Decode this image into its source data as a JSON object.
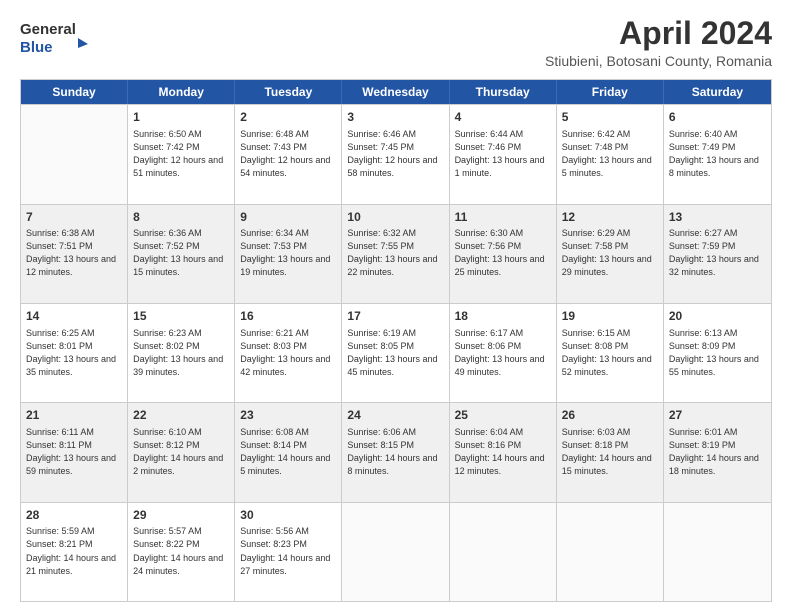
{
  "header": {
    "logo_line1": "General",
    "logo_line2": "Blue",
    "title": "April 2024",
    "subtitle": "Stiubieni, Botosani County, Romania"
  },
  "days_of_week": [
    "Sunday",
    "Monday",
    "Tuesday",
    "Wednesday",
    "Thursday",
    "Friday",
    "Saturday"
  ],
  "weeks": [
    [
      {
        "day": "",
        "info": ""
      },
      {
        "day": "1",
        "info": "Sunrise: 6:50 AM\nSunset: 7:42 PM\nDaylight: 12 hours\nand 51 minutes."
      },
      {
        "day": "2",
        "info": "Sunrise: 6:48 AM\nSunset: 7:43 PM\nDaylight: 12 hours\nand 54 minutes."
      },
      {
        "day": "3",
        "info": "Sunrise: 6:46 AM\nSunset: 7:45 PM\nDaylight: 12 hours\nand 58 minutes."
      },
      {
        "day": "4",
        "info": "Sunrise: 6:44 AM\nSunset: 7:46 PM\nDaylight: 13 hours\nand 1 minute."
      },
      {
        "day": "5",
        "info": "Sunrise: 6:42 AM\nSunset: 7:48 PM\nDaylight: 13 hours\nand 5 minutes."
      },
      {
        "day": "6",
        "info": "Sunrise: 6:40 AM\nSunset: 7:49 PM\nDaylight: 13 hours\nand 8 minutes."
      }
    ],
    [
      {
        "day": "7",
        "info": "Sunrise: 6:38 AM\nSunset: 7:51 PM\nDaylight: 13 hours\nand 12 minutes."
      },
      {
        "day": "8",
        "info": "Sunrise: 6:36 AM\nSunset: 7:52 PM\nDaylight: 13 hours\nand 15 minutes."
      },
      {
        "day": "9",
        "info": "Sunrise: 6:34 AM\nSunset: 7:53 PM\nDaylight: 13 hours\nand 19 minutes."
      },
      {
        "day": "10",
        "info": "Sunrise: 6:32 AM\nSunset: 7:55 PM\nDaylight: 13 hours\nand 22 minutes."
      },
      {
        "day": "11",
        "info": "Sunrise: 6:30 AM\nSunset: 7:56 PM\nDaylight: 13 hours\nand 25 minutes."
      },
      {
        "day": "12",
        "info": "Sunrise: 6:29 AM\nSunset: 7:58 PM\nDaylight: 13 hours\nand 29 minutes."
      },
      {
        "day": "13",
        "info": "Sunrise: 6:27 AM\nSunset: 7:59 PM\nDaylight: 13 hours\nand 32 minutes."
      }
    ],
    [
      {
        "day": "14",
        "info": "Sunrise: 6:25 AM\nSunset: 8:01 PM\nDaylight: 13 hours\nand 35 minutes."
      },
      {
        "day": "15",
        "info": "Sunrise: 6:23 AM\nSunset: 8:02 PM\nDaylight: 13 hours\nand 39 minutes."
      },
      {
        "day": "16",
        "info": "Sunrise: 6:21 AM\nSunset: 8:03 PM\nDaylight: 13 hours\nand 42 minutes."
      },
      {
        "day": "17",
        "info": "Sunrise: 6:19 AM\nSunset: 8:05 PM\nDaylight: 13 hours\nand 45 minutes."
      },
      {
        "day": "18",
        "info": "Sunrise: 6:17 AM\nSunset: 8:06 PM\nDaylight: 13 hours\nand 49 minutes."
      },
      {
        "day": "19",
        "info": "Sunrise: 6:15 AM\nSunset: 8:08 PM\nDaylight: 13 hours\nand 52 minutes."
      },
      {
        "day": "20",
        "info": "Sunrise: 6:13 AM\nSunset: 8:09 PM\nDaylight: 13 hours\nand 55 minutes."
      }
    ],
    [
      {
        "day": "21",
        "info": "Sunrise: 6:11 AM\nSunset: 8:11 PM\nDaylight: 13 hours\nand 59 minutes."
      },
      {
        "day": "22",
        "info": "Sunrise: 6:10 AM\nSunset: 8:12 PM\nDaylight: 14 hours\nand 2 minutes."
      },
      {
        "day": "23",
        "info": "Sunrise: 6:08 AM\nSunset: 8:14 PM\nDaylight: 14 hours\nand 5 minutes."
      },
      {
        "day": "24",
        "info": "Sunrise: 6:06 AM\nSunset: 8:15 PM\nDaylight: 14 hours\nand 8 minutes."
      },
      {
        "day": "25",
        "info": "Sunrise: 6:04 AM\nSunset: 8:16 PM\nDaylight: 14 hours\nand 12 minutes."
      },
      {
        "day": "26",
        "info": "Sunrise: 6:03 AM\nSunset: 8:18 PM\nDaylight: 14 hours\nand 15 minutes."
      },
      {
        "day": "27",
        "info": "Sunrise: 6:01 AM\nSunset: 8:19 PM\nDaylight: 14 hours\nand 18 minutes."
      }
    ],
    [
      {
        "day": "28",
        "info": "Sunrise: 5:59 AM\nSunset: 8:21 PM\nDaylight: 14 hours\nand 21 minutes."
      },
      {
        "day": "29",
        "info": "Sunrise: 5:57 AM\nSunset: 8:22 PM\nDaylight: 14 hours\nand 24 minutes."
      },
      {
        "day": "30",
        "info": "Sunrise: 5:56 AM\nSunset: 8:23 PM\nDaylight: 14 hours\nand 27 minutes."
      },
      {
        "day": "",
        "info": ""
      },
      {
        "day": "",
        "info": ""
      },
      {
        "day": "",
        "info": ""
      },
      {
        "day": "",
        "info": ""
      }
    ]
  ]
}
